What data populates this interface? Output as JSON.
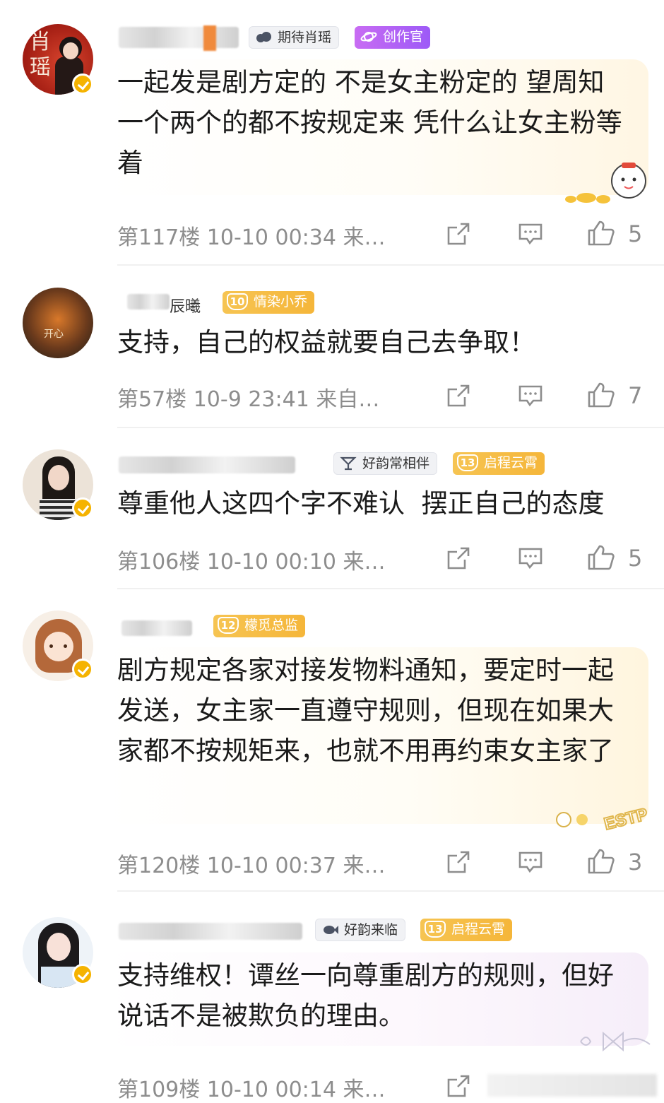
{
  "comments": [
    {
      "tags": [
        "期待肖瑶",
        "创作官"
      ],
      "avatar_text": "肖瑶",
      "text": "一起发是剧方定的 不是女主粉定的 望周知 一个两个的都不按规定来 凭什么让女主粉等着",
      "meta": "第117楼 10-10 00:34 来…",
      "likes": "5"
    },
    {
      "name_partial": "辰曦",
      "tag_level": "10",
      "tags": [
        "情染小乔"
      ],
      "avatar_text": "开心",
      "text": "支持，自己的权益就要自己去争取！",
      "meta": "第57楼 10-9 23:41 来自…",
      "likes": "7"
    },
    {
      "tag_level": "13",
      "tags": [
        "好韵常相伴",
        "启程云霄"
      ],
      "text": "尊重他人这四个字不难认  摆正自己的态度",
      "meta": "第106楼 10-10 00:10 来…",
      "likes": "5"
    },
    {
      "tag_level": "12",
      "tags": [
        "檬觅总监"
      ],
      "bubble_decoration": "ESTP",
      "text": "剧方规定各家对接发物料通知，要定时一起发送，女主家一直遵守规则，但现在如果大家都不按规矩来，也就不用再约束女主家了",
      "meta": "第120楼 10-10 00:37 来…",
      "likes": "3"
    },
    {
      "tag_level": "13",
      "tags": [
        "好韵来临",
        "启程云霄"
      ],
      "text": "支持维权！谭丝一向尊重剧方的规则，但好说话不是被欺负的理由。",
      "meta": "第109楼 10-10 00:14 来…",
      "likes": ""
    }
  ],
  "colors": {
    "meta_text": "#8d8d8d",
    "verified_badge": "#f5b301",
    "tag_gold": "#f5b63a",
    "tag_purple": "#b063f5"
  },
  "icons": [
    "share-icon",
    "comment-icon",
    "thumbs-up-icon",
    "verified-badge-icon"
  ]
}
